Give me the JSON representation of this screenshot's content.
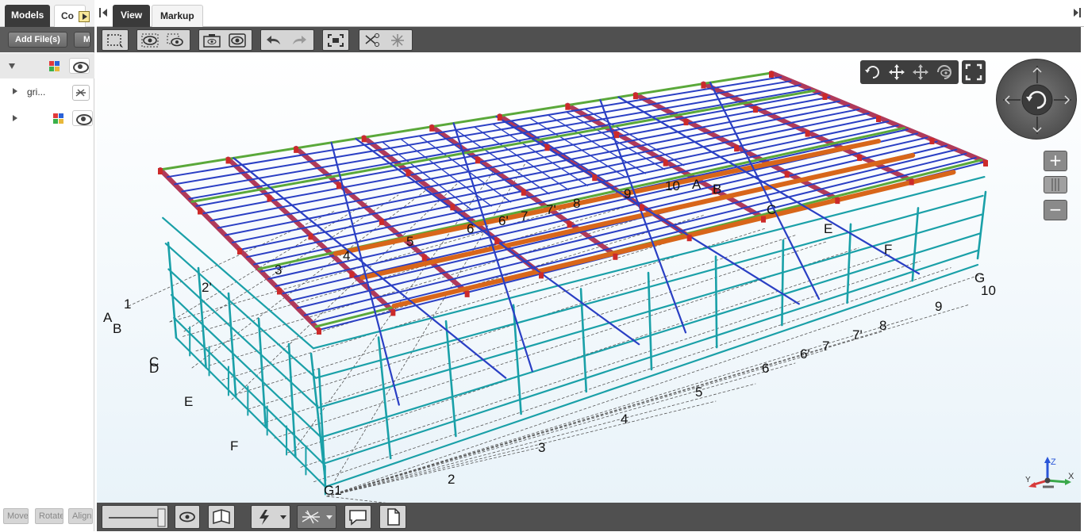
{
  "left_panel": {
    "tabs": {
      "models": "Models",
      "second": "Co"
    },
    "toolbar": {
      "add_files": "Add File(s)",
      "m": "M"
    },
    "tree": [
      {
        "label": ""
      },
      {
        "label": "gri..."
      },
      {
        "label": ""
      }
    ],
    "bottom_buttons": {
      "move": "Move",
      "rotate": "Rotate",
      "align": "Align"
    }
  },
  "main_tabs": {
    "view": "View",
    "markup": "Markup"
  },
  "toolbar_icons": [
    "select-box-icon",
    "show-selected-icon",
    "hide-selected-icon",
    "camera-view-icon",
    "eye-view-icon",
    "undo-icon",
    "redo-icon",
    "fit-view-icon",
    "section-cut-icon",
    "explode-icon"
  ],
  "grid_labels": {
    "left_letters": [
      "A",
      "B",
      "C",
      "D",
      "E",
      "F",
      "G1"
    ],
    "front_numbers": [
      "1",
      "2",
      "2'",
      "3",
      "4",
      "5",
      "6",
      "6'",
      "7",
      "7'",
      "8",
      "9",
      "10"
    ],
    "right_letters": [
      "A",
      "B",
      "C",
      "E",
      "F",
      "G"
    ],
    "top_numbers": [
      "3",
      "4",
      "5",
      "6",
      "6'",
      "7",
      "7'",
      "8",
      "9",
      "10"
    ]
  },
  "colors": {
    "toolbar_bg": "#505050",
    "column_teal": "#1aa0a8",
    "rafter_red": "#b03a5a",
    "purlin_blue": "#2a3fc4",
    "beam_orange": "#d8661a",
    "beam_green": "#5aa83a"
  }
}
